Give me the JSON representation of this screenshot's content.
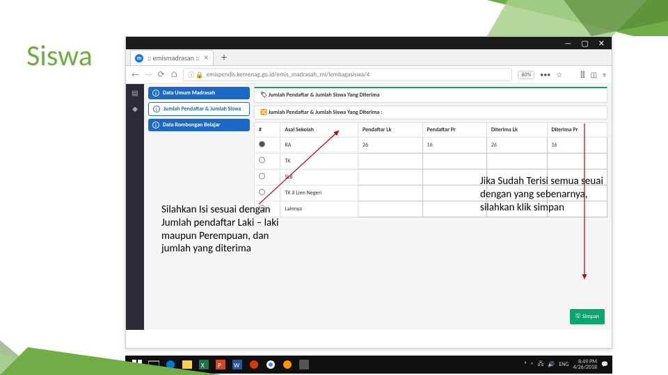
{
  "slide": {
    "title": "Siswa"
  },
  "window": {
    "tab_title": ":: emismadrasan ::",
    "url": "emispendis.kemenag.go.id/emis_madrasah_mi/lembagasiswa/4",
    "zoom": "80%",
    "minimize": "—",
    "maximize": "▢",
    "close": "✕"
  },
  "sidebar": {
    "items": [
      {
        "label": "Data Umum Madrasah"
      },
      {
        "label": "Jumlah Pendaftar & Jumlah Siswa"
      },
      {
        "label": "Data Rombongan Belajar"
      }
    ]
  },
  "panel": {
    "tag_icon": "🏷",
    "header": "Jumlah Pendaftar & Jumlah Siswa Yang Diterima",
    "subheader_icon": "🔀",
    "subheader": "Jumlah Pendaftar & Jumlah Siswa Yang Diterima :",
    "columns": [
      "#",
      "Asal Sekolah",
      "Pendaftar Lk",
      "Pendaftar Pr",
      "Diterima Lk",
      "Diterima Pr"
    ],
    "rows": [
      {
        "sel": true,
        "label": "RA",
        "v": [
          "26",
          "16",
          "26",
          "16"
        ]
      },
      {
        "sel": false,
        "label": "TK",
        "v": [
          "",
          "",
          "",
          ""
        ]
      },
      {
        "sel": false,
        "label": "SLB",
        "v": [
          "",
          "",
          "",
          ""
        ]
      },
      {
        "sel": false,
        "label": "TK Jl Lien Negeri",
        "v": [
          "",
          "",
          "",
          ""
        ]
      },
      {
        "sel": false,
        "label": "Lainnya",
        "v": [
          "",
          "",
          "",
          ""
        ]
      }
    ],
    "save": "Simpan"
  },
  "callouts": {
    "left": "Silahkan Isi sesuai dengan Jumlah pendaftar Laki – laki maupun Perempuan, dan jumlah yang diterima",
    "right": "Jika Sudah Terisi semua seuai dengan yang sebenarnya, silahkan klik simpan"
  },
  "taskbar": {
    "time": "8:49 PM",
    "date": "4/26/2018",
    "lang": "ENG"
  }
}
